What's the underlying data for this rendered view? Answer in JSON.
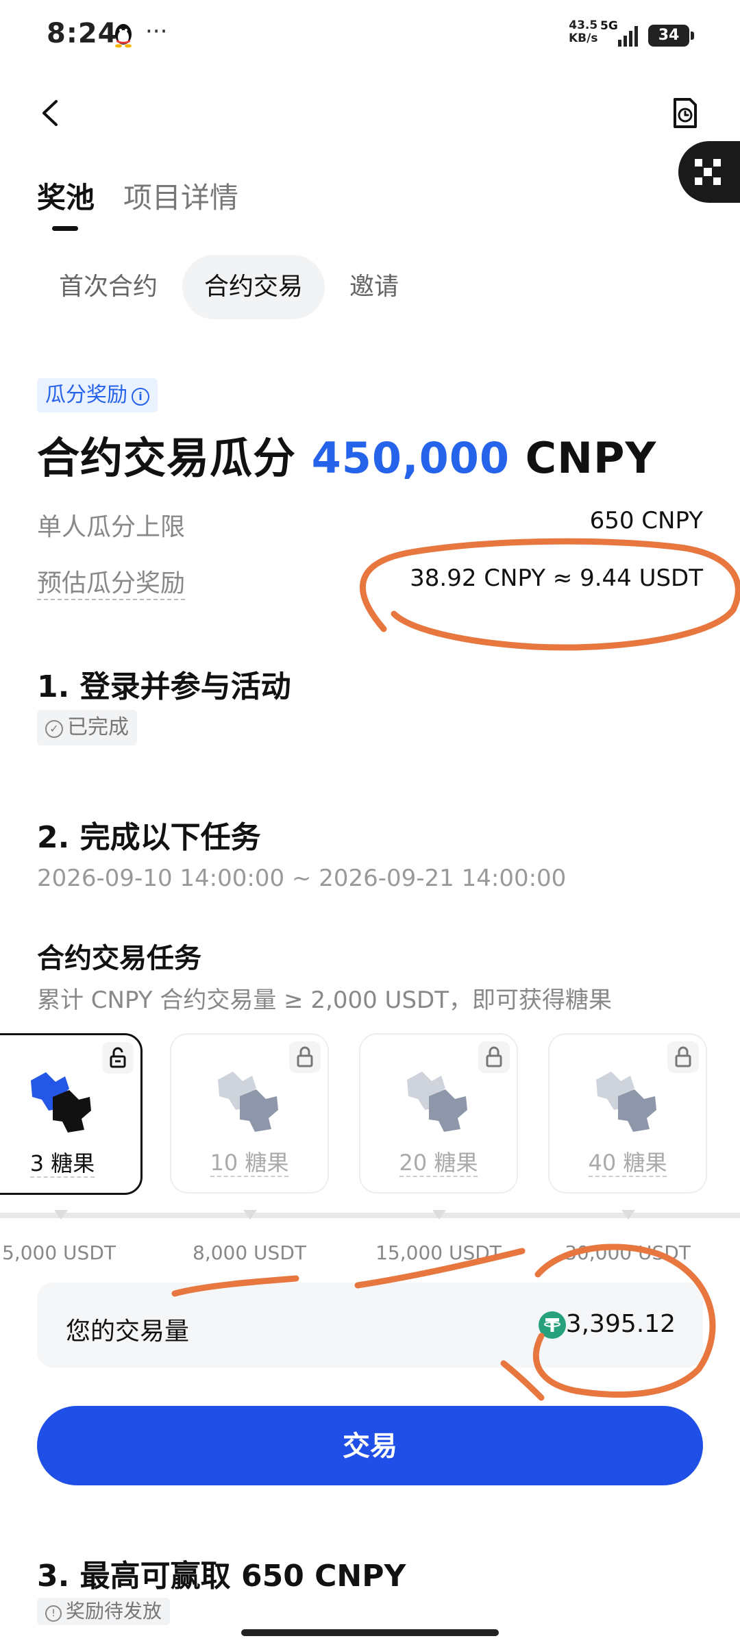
{
  "status_bar": {
    "time": "8:24",
    "dots": "···",
    "net_speed_value": "43.5",
    "net_speed_unit": "KB/s",
    "network": "5G",
    "battery": "34"
  },
  "nav": {
    "back_icon": "chevron-left-icon",
    "history_icon": "clock-document-icon",
    "float_icon": "grid-x-icon"
  },
  "main_tabs": [
    {
      "label": "奖池",
      "active": true
    },
    {
      "label": "项目详情",
      "active": false
    }
  ],
  "sub_tabs": [
    {
      "label": "首次合约",
      "active": false
    },
    {
      "label": "合约交易",
      "active": true
    },
    {
      "label": "邀请",
      "active": false
    }
  ],
  "reward": {
    "badge": "瓜分奖励",
    "headline_prefix": "合约交易瓜分",
    "headline_amount": "450,000",
    "headline_unit": "CNPY",
    "cap_label": "单人瓜分上限",
    "cap_value": "650 CNPY",
    "estimate_label": "预估瓜分奖励",
    "estimate_value": "38.92 CNPY ≈ 9.44 USDT"
  },
  "step1": {
    "title": "1. 登录并参与活动",
    "status": "已完成"
  },
  "step2": {
    "title": "2. 完成以下任务",
    "date_range": "2026-09-10 14:00:00 ~ 2026-09-21 14:00:00",
    "task_title": "合约交易任务",
    "task_desc": "累计 CNPY 合约交易量 ≥ 2,000 USDT，即可获得糖果",
    "tiers": [
      {
        "label": "3 糖果",
        "threshold": "5,000 USDT",
        "unlocked": true
      },
      {
        "label": "10 糖果",
        "threshold": "8,000 USDT",
        "unlocked": false
      },
      {
        "label": "20 糖果",
        "threshold": "15,000 USDT",
        "unlocked": false
      },
      {
        "label": "40 糖果",
        "threshold": "30,000 USDT",
        "unlocked": false
      }
    ],
    "volume_label": "您的交易量",
    "volume_value": "3,395.12",
    "trade_button": "交易"
  },
  "step3": {
    "title": "3. 最高可赢取 650 CNPY",
    "status": "奖励待发放"
  },
  "colors": {
    "accent": "#2563eb",
    "button": "#1f4fe6",
    "annotation": "#e8763f",
    "tether": "#26a17b"
  }
}
